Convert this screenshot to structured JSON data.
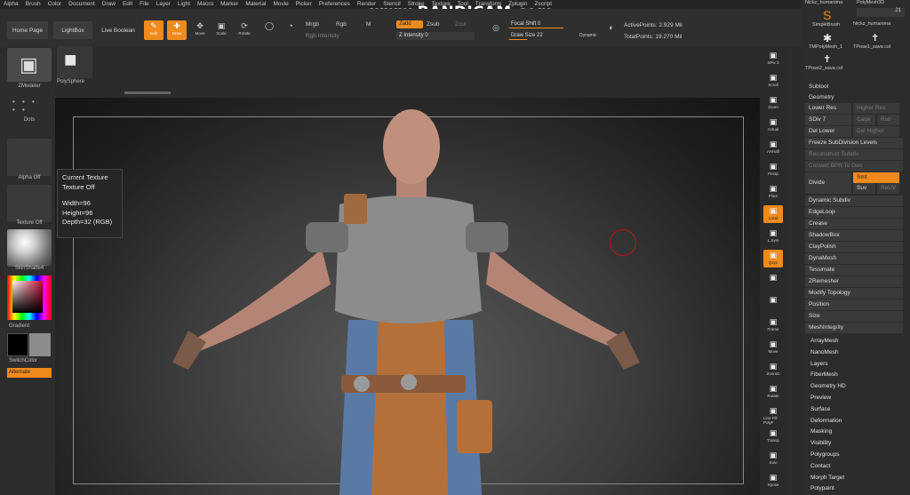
{
  "menu": [
    "Alpha",
    "Brush",
    "Color",
    "Document",
    "Draw",
    "Edit",
    "File",
    "Layer",
    "Light",
    "Macro",
    "Marker",
    "Material",
    "Movie",
    "Picker",
    "Preferences",
    "Render",
    "Stencil",
    "Stroke",
    "Texture",
    "Tool",
    "Transform",
    "Zplugin",
    "Zscript"
  ],
  "watermark": "www.BANDICAM.com",
  "toolbar": {
    "home_page": "Home Page",
    "lightbox": "LightBox",
    "live_boolean": "Live Boolean",
    "edit": "Edit",
    "draw": "Draw",
    "move": "Move",
    "scale": "Scale",
    "rotate": "Rotate",
    "mrgb": "Mrgb",
    "rgb": "Rgb",
    "m": "M",
    "rgb_intensity": "Rgb Intensity",
    "zadd": "Zadd",
    "zsub": "Zsub",
    "zcut": "Zcut",
    "z_intensity": "Z Intensity 0",
    "focal_shift": "Focal Shift 0",
    "draw_size": "Draw Size 22",
    "dynamic": "Dynamic",
    "active_points": "ActivePoints: 2.929 Mil",
    "total_points": "TotalPoints: 19.270 Mil"
  },
  "left_shelf": {
    "zmodeler": "ZModeler",
    "polysphere": "PolySphere",
    "dots": "Dots",
    "alpha_off": "Alpha Off",
    "texture_off": "Texture Off",
    "material": "SkinShade4",
    "gradient": "Gradient",
    "switch_color": "SwitchColor",
    "alternate": "Alternate"
  },
  "tooltip": {
    "title": "Current Texture",
    "value": "Texture Off",
    "width": "Width=96",
    "height": "Height=96",
    "depth": "Depth=32 (RGB)"
  },
  "right_shelf": [
    "SPix 3",
    "Scroll",
    "Zoom",
    "Actual",
    "AAHalf",
    "Persp",
    "Floor",
    "Local",
    "L.Sym",
    "Qxyz",
    "",
    "",
    "Frame",
    "Move",
    "ZoomD",
    "Rotate",
    "Line Fill PolyF",
    "Transp",
    "Solo",
    "Xpose"
  ],
  "right_panel": {
    "tool1": "Nickz_humanima",
    "tool2": "PolyMesh3D",
    "tool3": "SimpleBrush",
    "tool4": "Nickz_humanima",
    "count": "21",
    "tool5": "TMPolyMesh_1",
    "tool6": "TPose1_sava col",
    "tool7": "TPose2_sava col",
    "subtool": "Subtool",
    "geometry": "Geometry",
    "lower_res": "Lower Res",
    "higher_res": "Higher Res",
    "sdiv": "SDiv 7",
    "cage": "Cage",
    "rstr": "Rstr",
    "del_lower": "Del Lower",
    "del_higher": "Del Higher",
    "freeze": "Freeze SubDivision Levels",
    "reconstruct": "Reconstruct Subdiv",
    "convert": "Convert BPR To Geo",
    "divide": "Divide",
    "smt": "Smt",
    "suv": "Suv",
    "reuv": "ReUV",
    "subpanels": [
      "Dynamic Subdiv",
      "EdgeLoop",
      "Crease",
      "ShadowBox",
      "ClayPolish",
      "DynaMesh",
      "Tessimate",
      "ZRemesher",
      "Modify Topology",
      "Position",
      "Size",
      "MeshIntegrity"
    ],
    "sections": [
      "ArrayMesh",
      "NanoMesh",
      "Layers",
      "FiberMesh",
      "Geometry HD",
      "Preview",
      "Surface",
      "Deformation",
      "Masking",
      "Visibility",
      "Polygroups",
      "Contact",
      "Morph Target",
      "Polypaint"
    ]
  },
  "colors": {
    "accent": "#f08a1c",
    "panel": "#2c2c2c"
  }
}
